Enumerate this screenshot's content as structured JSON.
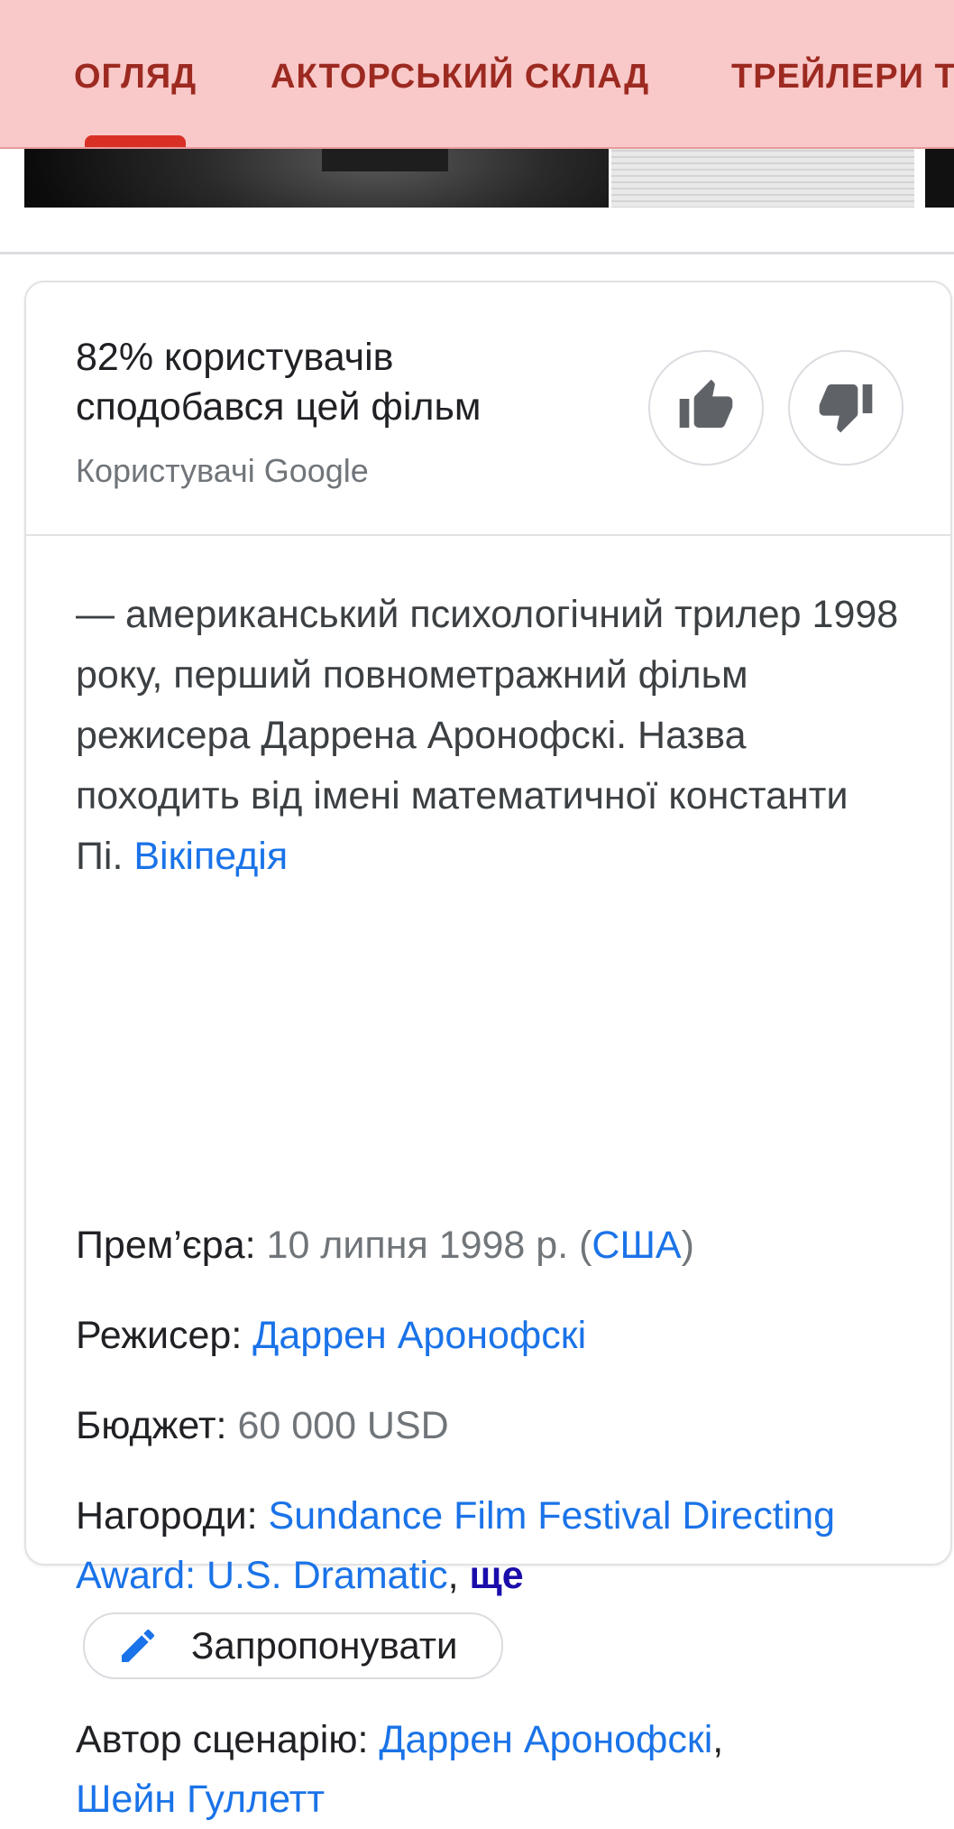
{
  "tabs": [
    {
      "label": "ОГЛЯД",
      "active": true
    },
    {
      "label": "АКТОРСЬКИЙ СКЛАД",
      "active": false
    },
    {
      "label": "ТРЕЙЛЕРИ Т",
      "active": false
    }
  ],
  "rating": {
    "line1": "82% користувачів",
    "line2": "сподобався цей фільм",
    "source": "Користувачі Google",
    "like_icon": "thumb-up-icon",
    "dislike_icon": "thumb-down-icon"
  },
  "description": {
    "text": "— американський психологічний трилер 1998 року, перший повнометражний фільм режисера Даррена Аронофскі. Назва походить від імені математичної константи Пі. ",
    "source_link": "Вікіпедія"
  },
  "facts": {
    "premiere": {
      "label": "Прем’єра:",
      "value": "10 липня 1998 р. (",
      "link": "США",
      "close": ")"
    },
    "director": {
      "label": "Режисер:",
      "link": "Даррен Аронофскі"
    },
    "budget": {
      "label": "Бюджет:",
      "value": "60 000 USD"
    },
    "awards": {
      "label": "Нагороди:",
      "link": "Sundance Film Festival Directing Award: U.S. Dramatic",
      "sep": ", ",
      "more": "ще"
    },
    "writer": {
      "label": "Автор сценарію:",
      "link1": "Даррен Аронофскі",
      "sep": ",",
      "link2": "Шейн Гуллетт"
    }
  },
  "suggest": {
    "label": "Запропонувати",
    "icon": "pencil-icon"
  },
  "colors": {
    "tab_bar_bg": "#f9c8c8",
    "tab_text": "#9c2a21",
    "tab_indicator": "#d93025",
    "link": "#1a73e8"
  }
}
